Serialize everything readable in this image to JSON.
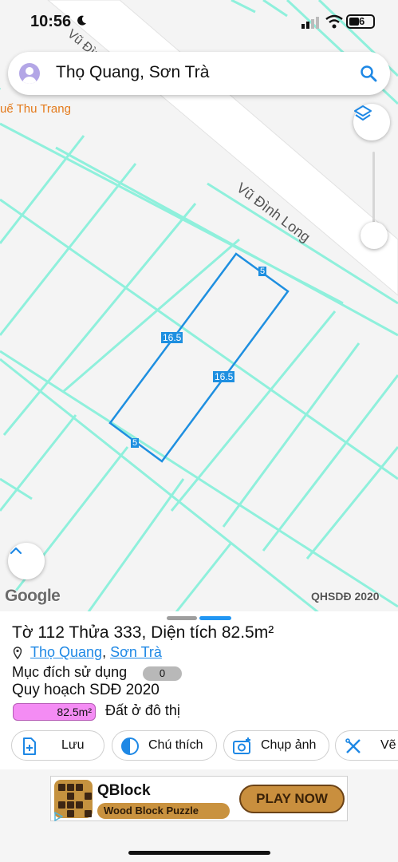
{
  "status_bar": {
    "time": "10:56",
    "battery": "6"
  },
  "search": {
    "query": "Thọ Quang, Sơn Trà"
  },
  "map": {
    "poi_label": "uế Thu Trang",
    "street_label": "Vũ Đình Long",
    "dimensions": [
      "5",
      "16.5",
      "16.5",
      "5"
    ],
    "logo_text": "Google",
    "attribution": "QHSDĐ 2020",
    "colors": {
      "grid_line": "#8ff0dc",
      "parcel": "#1e8fe0",
      "road": "#ffffff"
    }
  },
  "parcel": {
    "title": "Tờ 112 Thửa 333, Diện tích 82.5m²",
    "ward": "Thọ Quang",
    "separator": ", ",
    "district": "Sơn Trà",
    "purpose_label": "Mục đích sử dụng",
    "purpose_value": "0",
    "plan_label": "Quy hoạch SDĐ 2020",
    "plan_area": "82.5m²",
    "plan_type": "Đất ở đô thị"
  },
  "actions": [
    {
      "label": "Lưu",
      "icon": "add-file-icon"
    },
    {
      "label": "Chú thích",
      "icon": "half-circle-icon"
    },
    {
      "label": "Chụp ảnh",
      "icon": "camera-icon"
    },
    {
      "label": "Vẽ",
      "icon": "draw-icon"
    }
  ],
  "ad": {
    "title": "QBlock",
    "subtitle": "Wood Block Puzzle",
    "cta": "PLAY NOW"
  }
}
